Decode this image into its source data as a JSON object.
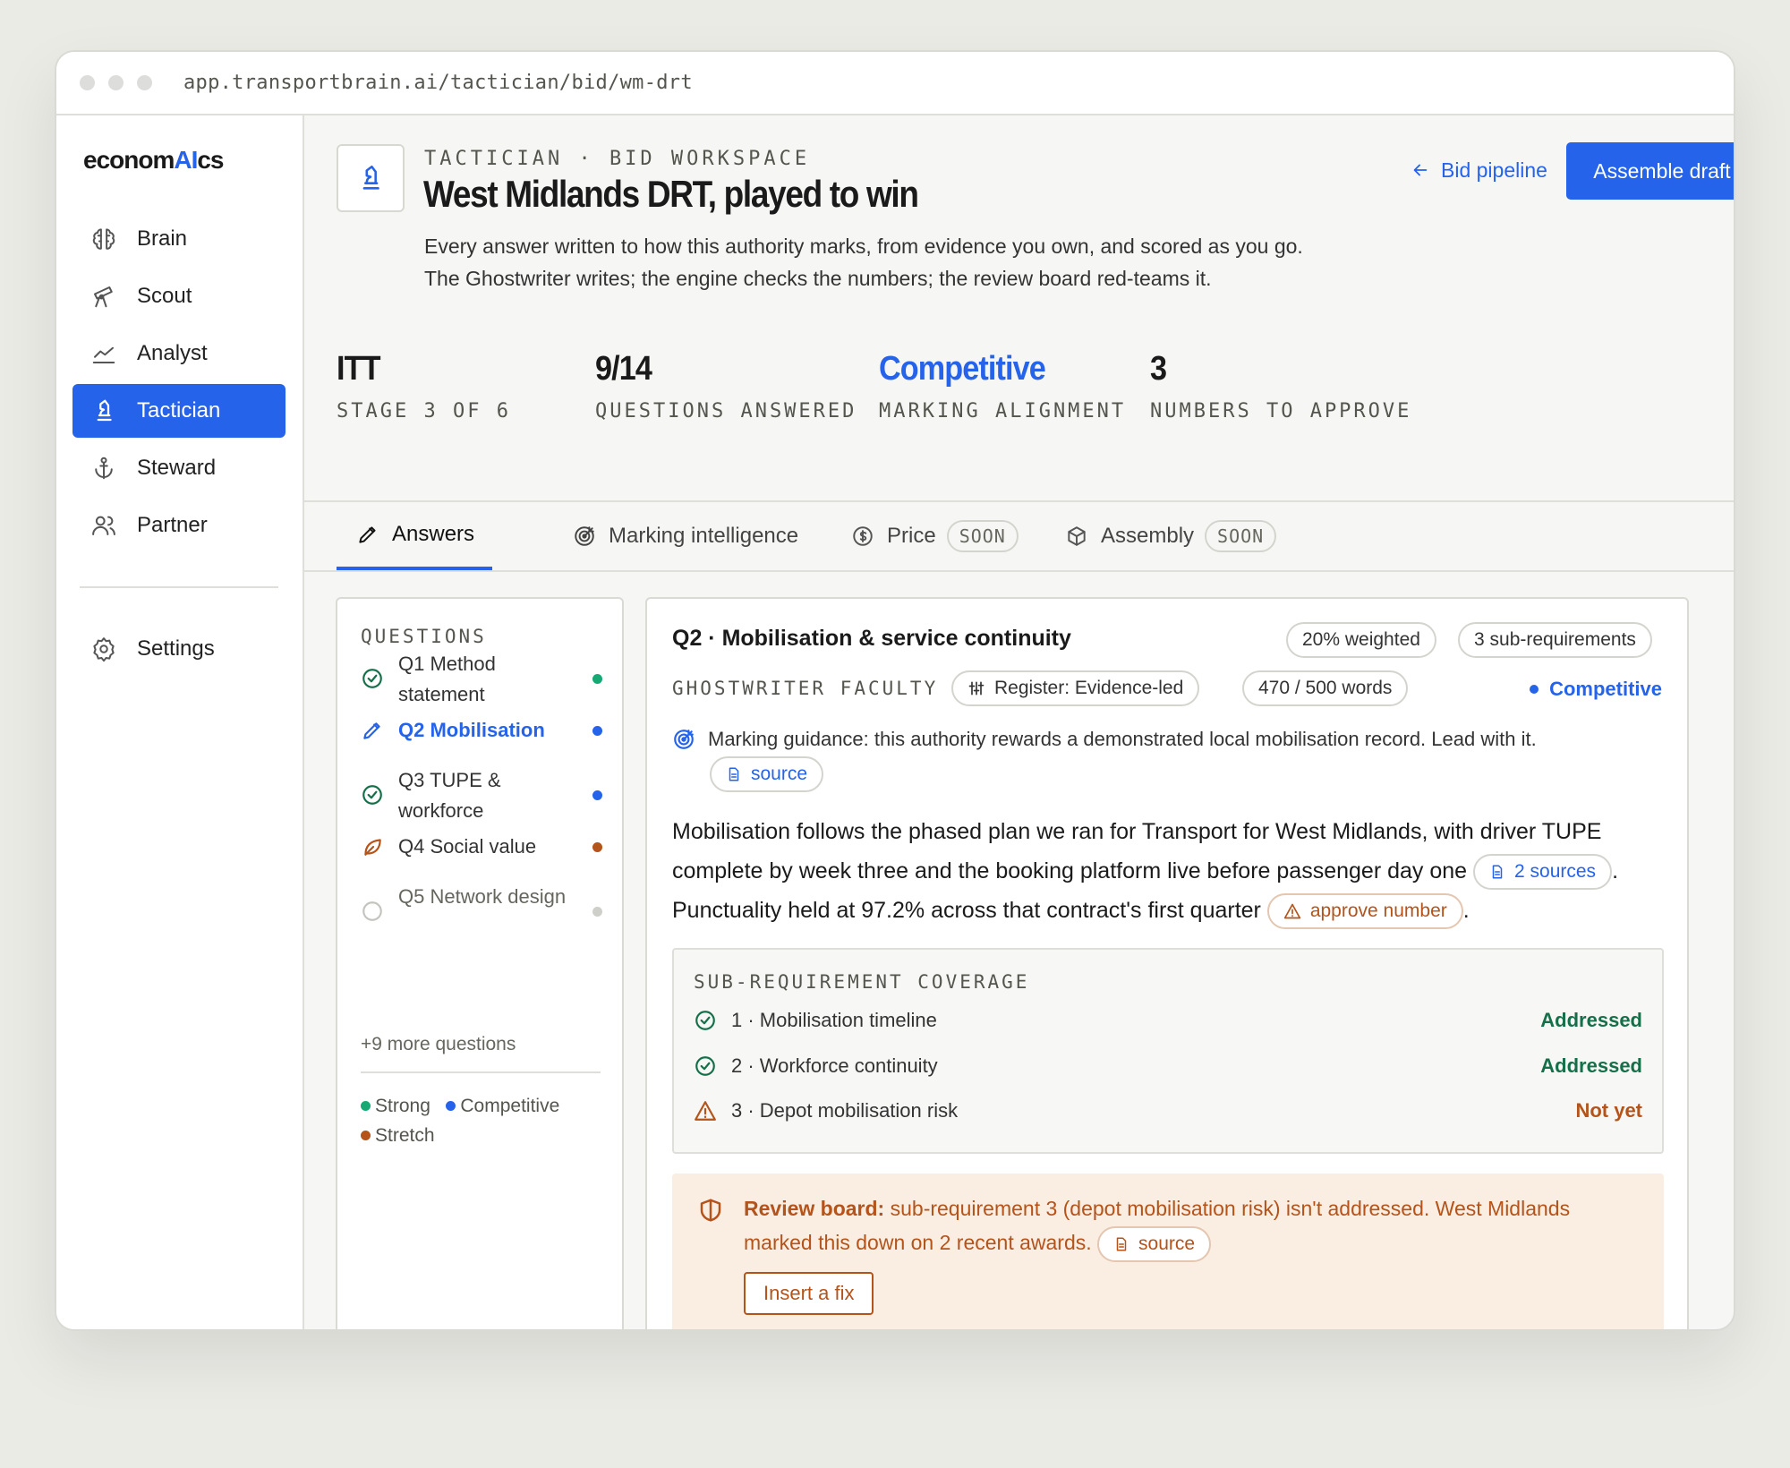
{
  "browser": {
    "url": "app.transportbrain.ai/tactician/bid/wm-drt"
  },
  "logo": {
    "prefix": "econom",
    "accent": "AI",
    "suffix": "cs"
  },
  "nav": {
    "items": [
      {
        "label": "Brain",
        "icon": "brain-icon"
      },
      {
        "label": "Scout",
        "icon": "telescope-icon"
      },
      {
        "label": "Analyst",
        "icon": "chart-line-icon"
      },
      {
        "label": "Tactician",
        "icon": "chess-knight-icon",
        "active": true
      },
      {
        "label": "Steward",
        "icon": "anchor-icon"
      },
      {
        "label": "Partner",
        "icon": "users-icon"
      }
    ],
    "settings": {
      "label": "Settings",
      "icon": "gear-icon"
    }
  },
  "header": {
    "eyebrow": "TACTICIAN · BID WORKSPACE",
    "title": "West Midlands DRT, played to win",
    "subtitle": "Every answer written to how this authority marks, from evidence you own, and scored as you go. The Ghostwriter writes; the engine checks the numbers; the review board red-teams it.",
    "back_label": "Bid pipeline",
    "primary_label": "Assemble draft"
  },
  "stats": [
    {
      "value": "ITT",
      "label": "STAGE 3 OF 6"
    },
    {
      "value": "9/14",
      "label": "QUESTIONS ANSWERED"
    },
    {
      "value": "Competitive",
      "label": "MARKING ALIGNMENT"
    },
    {
      "value": "3",
      "label": "NUMBERS TO APPROVE"
    }
  ],
  "tabs": [
    {
      "label": "Answers",
      "icon": "pencil-icon",
      "active": true
    },
    {
      "label": "Marking intelligence",
      "icon": "target-icon"
    },
    {
      "label": "Price",
      "icon": "dollar-circle-icon",
      "badge": "SOON"
    },
    {
      "label": "Assembly",
      "icon": "box-icon",
      "badge": "SOON"
    }
  ],
  "questions": {
    "heading": "QUESTIONS",
    "items": [
      {
        "label": "Q1 Method statement",
        "status": "done",
        "strength": "strong"
      },
      {
        "label": "Q2 Mobilisation",
        "status": "editing",
        "strength": "competitive"
      },
      {
        "label": "Q3 TUPE & workforce",
        "status": "done",
        "strength": "competitive"
      },
      {
        "label": "Q4 Social value",
        "status": "leaf",
        "strength": "stretch"
      },
      {
        "label": "Q5 Network design",
        "status": "empty",
        "strength": "none"
      }
    ],
    "more": "+9 more questions",
    "legend": {
      "strong": "Strong",
      "competitive": "Competitive",
      "stretch": "Stretch"
    }
  },
  "answer": {
    "title": "Q2 · Mobilisation & service continuity",
    "weight": "20% weighted",
    "subreq_count": "3 sub-requirements",
    "faculty": "GHOSTWRITER FACULTY",
    "register": "Register: Evidence-led",
    "words": "470 / 500 words",
    "status": "Competitive",
    "guidance": "Marking guidance: this authority rewards a demonstrated local mobilisation record. Lead with it.",
    "source_label": "source",
    "body_1": "Mobilisation follows the phased plan we ran for Transport for West Midlands, with driver TUPE complete by week three and the booking platform live before passenger day one",
    "sources_chip": "2 sources",
    "body_2": "Punctuality held at 97.2% across that contract's first quarter",
    "approve_chip": "approve number",
    "coverage": {
      "heading": "SUB-REQUIREMENT COVERAGE",
      "rows": [
        {
          "label": "1 · Mobilisation timeline",
          "status": "Addressed"
        },
        {
          "label": "2 · Workforce continuity",
          "status": "Addressed"
        },
        {
          "label": "3 · Depot mobilisation risk",
          "status": "Not yet"
        }
      ]
    },
    "review": {
      "lead": "Review board:",
      "text": "sub-requirement 3 (depot mobilisation risk) isn't addressed. West Midlands marked this down on 2 recent awards.",
      "source_label": "source",
      "fix_label": "Insert a fix"
    }
  },
  "colors": {
    "accent": "#2563eb",
    "strong": "#16a974",
    "competitive": "#2563eb",
    "stretch": "#b4531a",
    "addressed": "#15704a",
    "warning": "#b4531a",
    "review_bg": "#faeee3"
  }
}
